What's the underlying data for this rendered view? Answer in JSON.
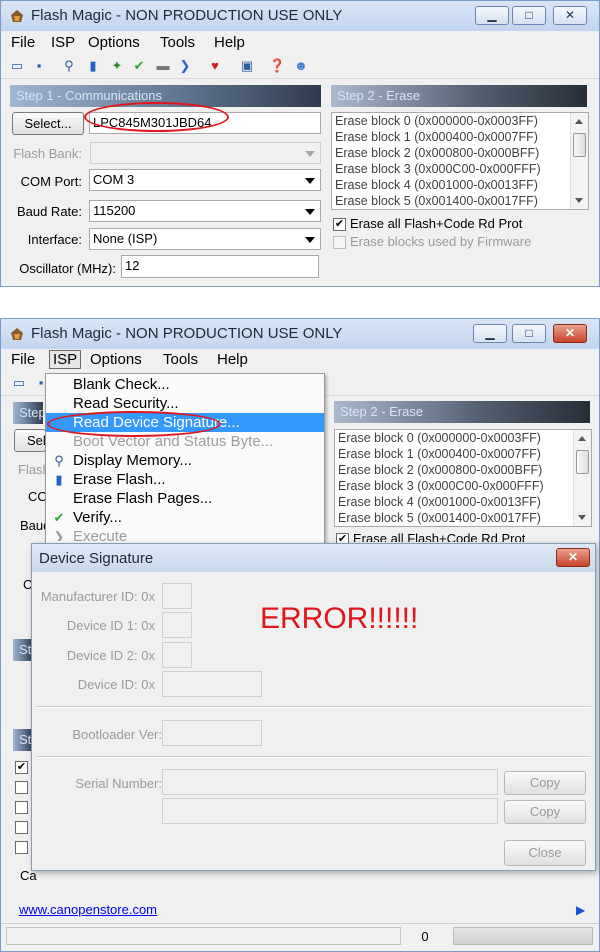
{
  "window": {
    "title": "Flash Magic - NON PRODUCTION USE ONLY",
    "minimize_label": "▁",
    "maximize_label": "□",
    "close_label": "✕"
  },
  "menu": {
    "file": "File",
    "isp": "ISP",
    "options": "Options",
    "tools": "Tools",
    "help": "Help"
  },
  "step1": {
    "header": "Step 1 - Communications",
    "select_button": "Select...",
    "device": "LPC845M301JBD64",
    "flash_bank_label": "Flash Bank:",
    "flash_bank_value": "",
    "com_port_label": "COM Port:",
    "com_port_value": "COM 3",
    "baud_label": "Baud Rate:",
    "baud_value": "115200",
    "interface_label": "Interface:",
    "interface_value": "None (ISP)",
    "osc_label": "Oscillator (MHz):",
    "osc_value": "12"
  },
  "step2": {
    "header": "Step 2 - Erase",
    "blocks": [
      "Erase block 0 (0x000000-0x0003FF)",
      "Erase block 1 (0x000400-0x0007FF)",
      "Erase block 2 (0x000800-0x000BFF)",
      "Erase block 3 (0x000C00-0x000FFF)",
      "Erase block 4 (0x001000-0x0013FF)",
      "Erase block 5 (0x001400-0x0017FF)"
    ],
    "erase_all": "Erase all Flash+Code Rd Prot",
    "erase_all_cut": "Erase all Flash+Code Rd Prot",
    "erase_firmware": "Erase blocks used by Firmware"
  },
  "isp_menu": {
    "items": [
      {
        "label": "Blank Check...",
        "icon": ""
      },
      {
        "label": "Read Security...",
        "icon": ""
      },
      {
        "label": "Read Device Signature...",
        "icon": ""
      },
      {
        "label": "Boot Vector and Status Byte...",
        "icon": ""
      },
      {
        "label": "Display Memory...",
        "icon": "magnifier-icon"
      },
      {
        "label": "Erase Flash...",
        "icon": "database-icon"
      },
      {
        "label": "Erase Flash Pages...",
        "icon": ""
      },
      {
        "label": "Verify...",
        "icon": "check-icon"
      },
      {
        "label": "Execute",
        "icon": "arrow-icon"
      }
    ]
  },
  "dialog": {
    "title": "Device Signature",
    "close_label": "✕",
    "manufacturer_label": "Manufacturer ID: 0x",
    "device1_label": "Device ID 1: 0x",
    "device2_label": "Device ID 2: 0x",
    "device_label": "Device ID: 0x",
    "bootloader_label": "Bootloader Ver:",
    "serial_label": "Serial Number:",
    "copy_label": "Copy",
    "close_button": "Close",
    "error_text": "ERROR!!!!!!"
  },
  "footer": {
    "link": "www.canopenstore.com",
    "status_value": "0",
    "partial_label": "Ca"
  },
  "colors": {
    "annotation": "#e0161c",
    "highlight": "#3399ff",
    "link": "#0000ee"
  }
}
